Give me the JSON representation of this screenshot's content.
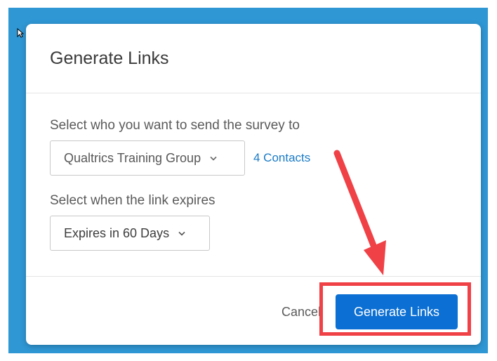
{
  "dialog": {
    "title": "Generate Links",
    "recipients_label": "Select who you want to send the survey to",
    "recipients_dropdown": {
      "selected": "Qualtrics Training Group",
      "icon": "chevron-down-icon"
    },
    "contacts_link": "4 Contacts",
    "expiration_label": "Select when the link expires",
    "expiration_dropdown": {
      "selected": "Expires in 60 Days",
      "icon": "chevron-down-icon"
    },
    "footer": {
      "cancel_label": "Cancel",
      "generate_label": "Generate Links"
    }
  },
  "annotation": {
    "arrow_color": "#ef4146",
    "highlight_color": "#ef4146"
  },
  "colors": {
    "backdrop": "#2f97d4",
    "primary_button": "#0b6fd3",
    "link": "#1a7bc6"
  }
}
